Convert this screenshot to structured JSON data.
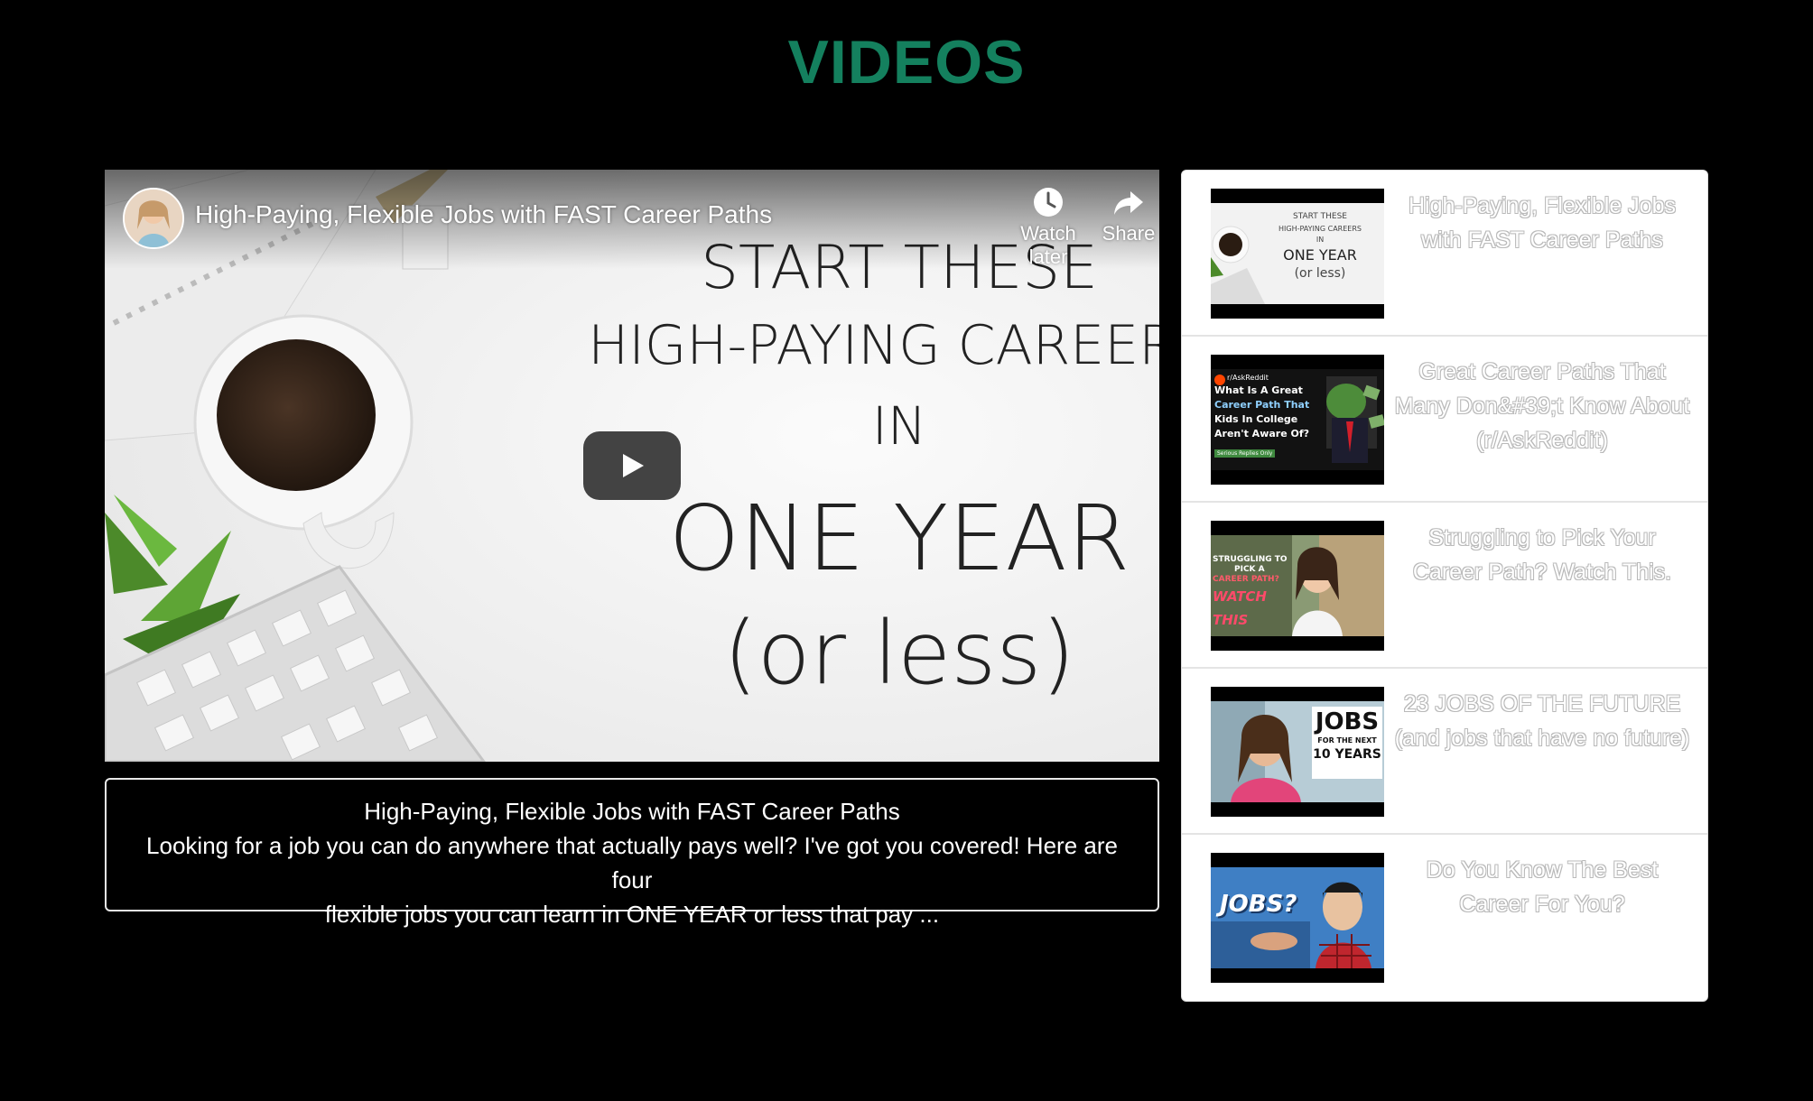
{
  "page": {
    "title": "VIDEOS"
  },
  "player": {
    "title": "High-Paying, Flexible Jobs with FAST Career Paths",
    "watch_later_label": "Watch later",
    "share_label": "Share",
    "thumbnail_text": {
      "line1": "START THESE",
      "line2": "HIGH-PAYING CAREERS",
      "line3": "IN",
      "line4": "ONE YEAR",
      "line5": "(or less)"
    }
  },
  "description": {
    "title": "High-Paying, Flexible Jobs with FAST Career Paths",
    "line1": "Looking for a job you can do anywhere that actually pays well? I've got you covered! Here are four",
    "line2": "flexible jobs you can learn in ONE YEAR or less that pay ..."
  },
  "playlist": {
    "items": [
      {
        "title": "High-Paying, Flexible Jobs with FAST Career Paths",
        "thumb_text": {
          "l1": "START THESE",
          "l2": "HIGH-PAYING CAREERS",
          "l3": "IN",
          "l4": "ONE YEAR",
          "l5": "(or less)"
        }
      },
      {
        "title": "Great Career Paths That Many Don&#39;t Know About (r/AskReddit)",
        "thumb_text": {
          "l0": "r/AskReddit",
          "l1": "What Is A Great",
          "l2": "Career Path That",
          "l3": "Kids In College",
          "l4": "Aren't Aware Of?",
          "l5": "Serious Replies Only"
        }
      },
      {
        "title": "Struggling to Pick Your Career Path? Watch This.",
        "thumb_text": {
          "l1": "STRUGGLING TO",
          "l2": "PICK A",
          "l3": "CAREER PATH?",
          "l4": "WATCH THIS"
        }
      },
      {
        "title": "23 JOBS OF THE FUTURE (and jobs that have no future)",
        "thumb_text": {
          "l1": "JOBS",
          "l2": "FOR THE NEXT",
          "l3": "10 YEARS"
        }
      },
      {
        "title": "Do You Know The Best Career For You?",
        "thumb_text": {
          "l1": "JOBS?"
        }
      }
    ]
  },
  "colors": {
    "title_green": "#14805e",
    "background": "#000000"
  }
}
